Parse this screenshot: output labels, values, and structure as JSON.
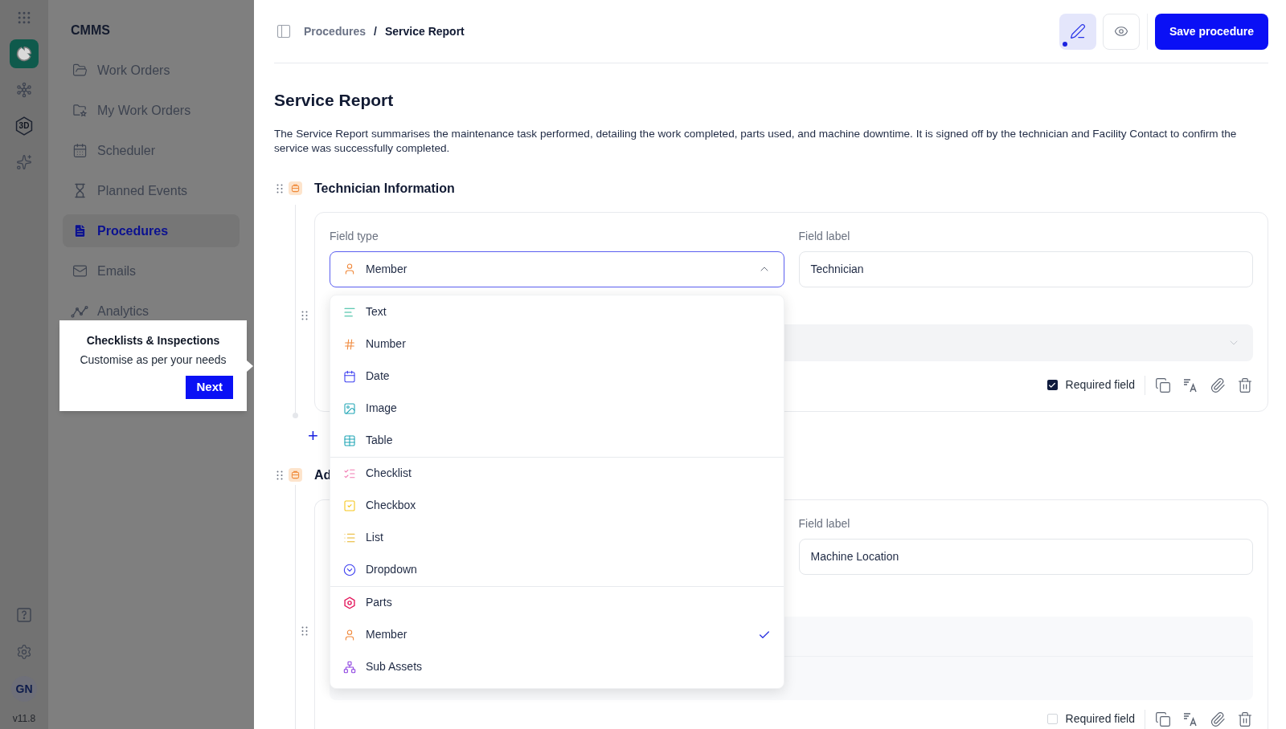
{
  "rail": {
    "top": [
      {
        "kind": "apps",
        "selected": false
      },
      {
        "kind": "cmms",
        "selected": true
      },
      {
        "kind": "network",
        "selected": false
      },
      {
        "kind": "hexagon",
        "label": "3D",
        "selected": false
      },
      {
        "kind": "ai",
        "selected": false
      }
    ],
    "bottom": [
      {
        "kind": "help"
      },
      {
        "kind": "settings"
      }
    ],
    "avatar": "GN",
    "version": "v11.8"
  },
  "sidebar": {
    "title": "CMMS",
    "items": [
      {
        "label": "Work Orders",
        "kind": "folder",
        "selected": false
      },
      {
        "label": "My Work Orders",
        "kind": "folder_star",
        "selected": false
      },
      {
        "label": "Scheduler",
        "kind": "calendar",
        "selected": false
      },
      {
        "label": "Planned Events",
        "kind": "hourglass",
        "selected": false
      },
      {
        "label": "Procedures",
        "kind": "document",
        "selected": true
      },
      {
        "label": "Emails",
        "kind": "mail",
        "selected": false
      },
      {
        "label": "Analytics",
        "kind": "analytics",
        "selected": false
      }
    ]
  },
  "tour_tip": {
    "title": "Checklists & Inspections",
    "text": "Customise as per your needs",
    "button": "Next"
  },
  "header": {
    "breadcrumb": [
      "Procedures",
      "Service Report"
    ],
    "separator": "/",
    "mode_buttons": [
      {
        "kind": "edit",
        "selected": true
      },
      {
        "kind": "preview",
        "selected": false
      }
    ],
    "save_button": "Save procedure"
  },
  "page": {
    "title": "Service Report",
    "description": "The Service Report summarises the maintenance task performed, detailing the work completed, parts used, and machine downtime. It is signed off by the technician and Facility Contact to confirm the service was successfully completed."
  },
  "sections": [
    {
      "title": "Technician Information",
      "field": {
        "field_type_label": "Field type",
        "field_type": {
          "kind": "member",
          "value": "Member",
          "expanded": true
        },
        "field_label_label": "Field label",
        "field_label": "Technician",
        "kind": "select",
        "required_label": "Required field",
        "required": true
      }
    },
    {
      "title": "Ad",
      "field": {
        "field_label_label": "Field label",
        "field_label": "Machine Location",
        "kind": "list",
        "required_label": "Required field",
        "required": false
      }
    }
  ],
  "field_type_menu": {
    "groups": [
      [
        {
          "label": "Text",
          "kind": "text",
          "selected": false
        },
        {
          "label": "Number",
          "kind": "number",
          "selected": false
        },
        {
          "label": "Date",
          "kind": "date",
          "selected": false
        },
        {
          "label": "Image",
          "kind": "image",
          "selected": false
        },
        {
          "label": "Table",
          "kind": "table",
          "selected": false
        }
      ],
      [
        {
          "label": "Checklist",
          "kind": "checklist",
          "selected": false
        },
        {
          "label": "Checkbox",
          "kind": "checkbox",
          "selected": false
        },
        {
          "label": "List",
          "kind": "list",
          "selected": false
        },
        {
          "label": "Dropdown",
          "kind": "dropdown",
          "selected": false
        }
      ],
      [
        {
          "label": "Parts",
          "kind": "parts",
          "selected": false
        },
        {
          "label": "Member",
          "kind": "member",
          "selected": true
        },
        {
          "label": "Sub Assets",
          "kind": "sub_assets",
          "selected": false
        }
      ]
    ]
  },
  "add_button": "+"
}
